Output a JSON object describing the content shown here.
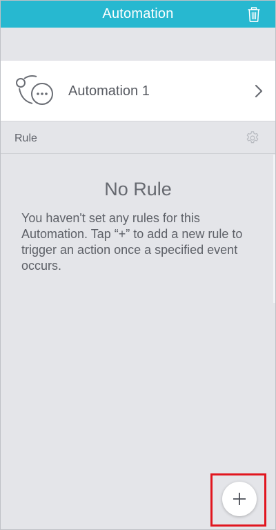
{
  "header": {
    "title": "Automation",
    "delete_icon": "trash-icon",
    "color": "#27b8d0"
  },
  "automation": {
    "name": "Automation 1",
    "icon": "automation-cycle-icon",
    "chevron_icon": "chevron-right-icon"
  },
  "rule_section": {
    "label": "Rule",
    "settings_icon": "gear-icon"
  },
  "empty_state": {
    "title": "No Rule",
    "description": "You haven't set any rules for this Automation. Tap “+” to add a new rule to trigger an action once a specified event occurs."
  },
  "fab": {
    "icon": "plus-icon"
  },
  "highlight_color": "#e1161f"
}
